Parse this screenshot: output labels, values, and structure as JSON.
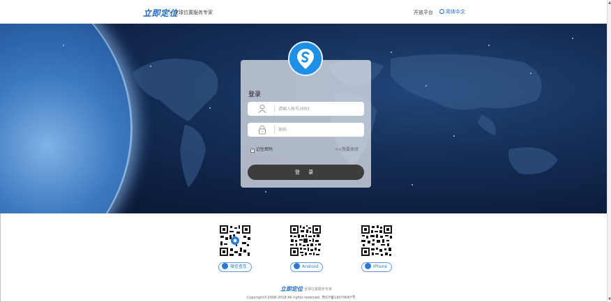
{
  "header": {
    "logo": "立即定位",
    "slogan": "全球位置服务专家",
    "open_platform": "开放平台",
    "language": "简体中文"
  },
  "login": {
    "title": "登录",
    "username_placeholder": "请输入账号/IMEI",
    "password_placeholder": "密码",
    "remember_label": "记住密码",
    "demo_link": "<<我要体验",
    "submit_label": "登 录"
  },
  "downloads": [
    {
      "label": "微信查车",
      "icon": "wechat-icon"
    },
    {
      "label": "Android",
      "icon": "android-icon"
    },
    {
      "label": "iPhone",
      "icon": "apple-icon"
    }
  ],
  "footer": {
    "logo": "立即定位",
    "slogan": "全球位置服务专家",
    "copyright": "Copyright©2008-2018 All rights reserved. 粤ICP备16079067号"
  },
  "colors": {
    "brand": "#1a68c9",
    "badge": "#1d8fe6",
    "button_dark": "#3d3d3d"
  }
}
